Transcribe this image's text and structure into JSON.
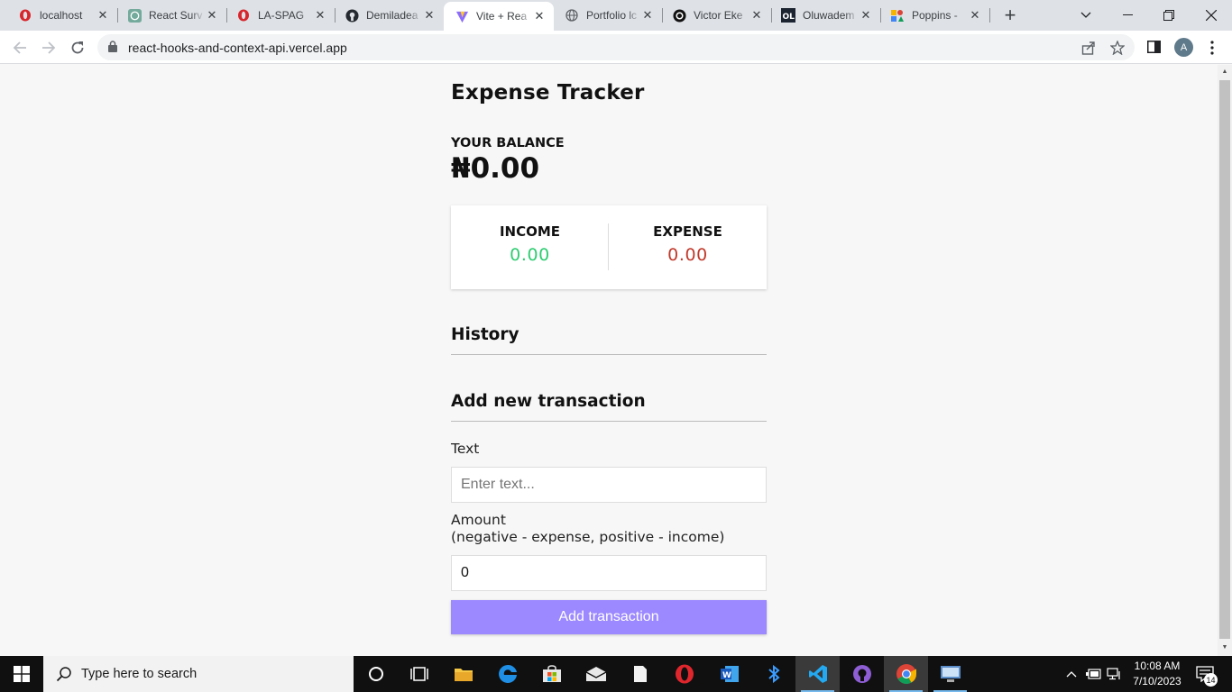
{
  "browser": {
    "tabs": [
      {
        "label": "localhost",
        "icon": "opera-icon"
      },
      {
        "label": "React Surv",
        "icon": "chatgpt-icon"
      },
      {
        "label": "LA-SPAG",
        "icon": "opera-icon"
      },
      {
        "label": "Demiladea",
        "icon": "github-icon"
      },
      {
        "label": "Vite + Rea",
        "icon": "vite-icon",
        "active": true
      },
      {
        "label": "Portfolio lc",
        "icon": "globe-icon"
      },
      {
        "label": "Victor Eke",
        "icon": "site-icon"
      },
      {
        "label": "Oluwadem",
        "icon": "ol-icon"
      },
      {
        "label": "Poppins - ",
        "icon": "google-fonts-icon"
      }
    ],
    "url": "react-hooks-and-context-api.vercel.app",
    "profile_initial": "A"
  },
  "app": {
    "title": "Expense Tracker",
    "balance_label": "YOUR BALANCE",
    "balance_amount": "₦0.00",
    "income_label": "INCOME",
    "income_amount": "0.00",
    "expense_label": "EXPENSE",
    "expense_amount": "0.00",
    "history_heading": "History",
    "add_heading": "Add new transaction",
    "text_label": "Text",
    "text_placeholder": "Enter text...",
    "amount_label": "Amount",
    "amount_hint": "(negative - expense, positive - income)",
    "amount_value": "0",
    "submit_label": "Add transaction",
    "colors": {
      "income": "#2ecc71",
      "expense": "#c0392b",
      "button": "#9c88ff"
    }
  },
  "taskbar": {
    "search_placeholder": "Type here to search",
    "time": "10:08 AM",
    "date": "7/10/2023",
    "notification_count": "14"
  }
}
